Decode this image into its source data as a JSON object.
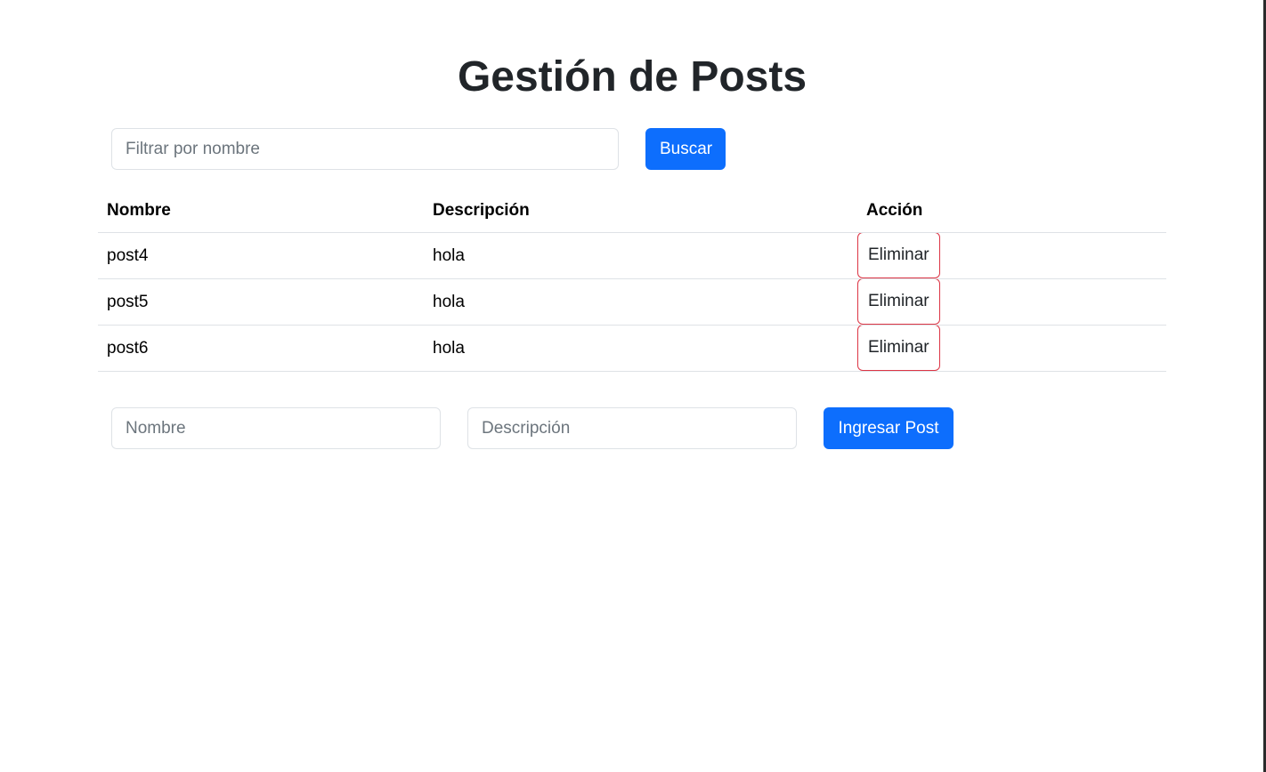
{
  "page": {
    "title": "Gestión de Posts"
  },
  "filter": {
    "placeholder": "Filtrar por nombre",
    "value": "",
    "search_label": "Buscar"
  },
  "table": {
    "headers": {
      "name": "Nombre",
      "description": "Descripción",
      "action": "Acción"
    },
    "rows": [
      {
        "name": "post4",
        "description": "hola",
        "action_label": "Eliminar"
      },
      {
        "name": "post5",
        "description": "hola",
        "action_label": "Eliminar"
      },
      {
        "name": "post6",
        "description": "hola",
        "action_label": "Eliminar"
      }
    ]
  },
  "create_form": {
    "name_placeholder": "Nombre",
    "name_value": "",
    "description_placeholder": "Descripción",
    "description_value": "",
    "submit_label": "Ingresar Post"
  },
  "colors": {
    "primary": "#0d6efd",
    "danger": "#dc3545",
    "text": "#212529",
    "border": "#dee2e6"
  }
}
